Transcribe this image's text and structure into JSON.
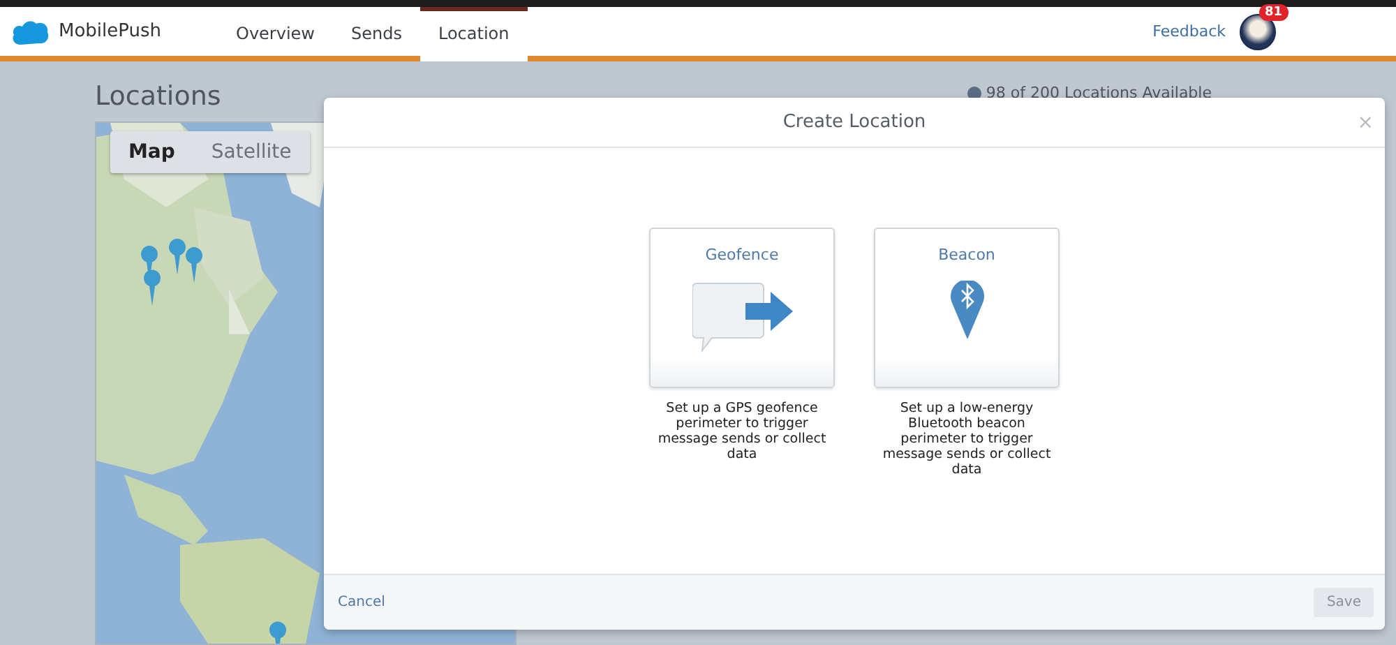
{
  "app": {
    "name": "MobilePush"
  },
  "nav_tabs": [
    {
      "label": "Overview",
      "selected": false
    },
    {
      "label": "Sends",
      "selected": false
    },
    {
      "label": "Location",
      "selected": true
    }
  ],
  "feedback_link": "Feedback",
  "notification_count": "81",
  "page": {
    "title": "Locations",
    "availability": "98 of 200 Locations Available"
  },
  "map": {
    "view_tabs": [
      {
        "label": "Map",
        "selected": true
      },
      {
        "label": "Satellite",
        "selected": false
      }
    ]
  },
  "modal": {
    "title": "Create Location",
    "close": "×",
    "options": [
      {
        "kind": "geofence",
        "title": "Geofence",
        "description": "Set up a GPS geofence perimeter to trigger message sends or collect data"
      },
      {
        "kind": "beacon",
        "title": "Beacon",
        "description": "Set up a low-energy Bluetooth beacon perimeter to trigger message sends or collect data"
      }
    ],
    "cancel": "Cancel",
    "save": {
      "label": "Save",
      "disabled": true
    }
  }
}
